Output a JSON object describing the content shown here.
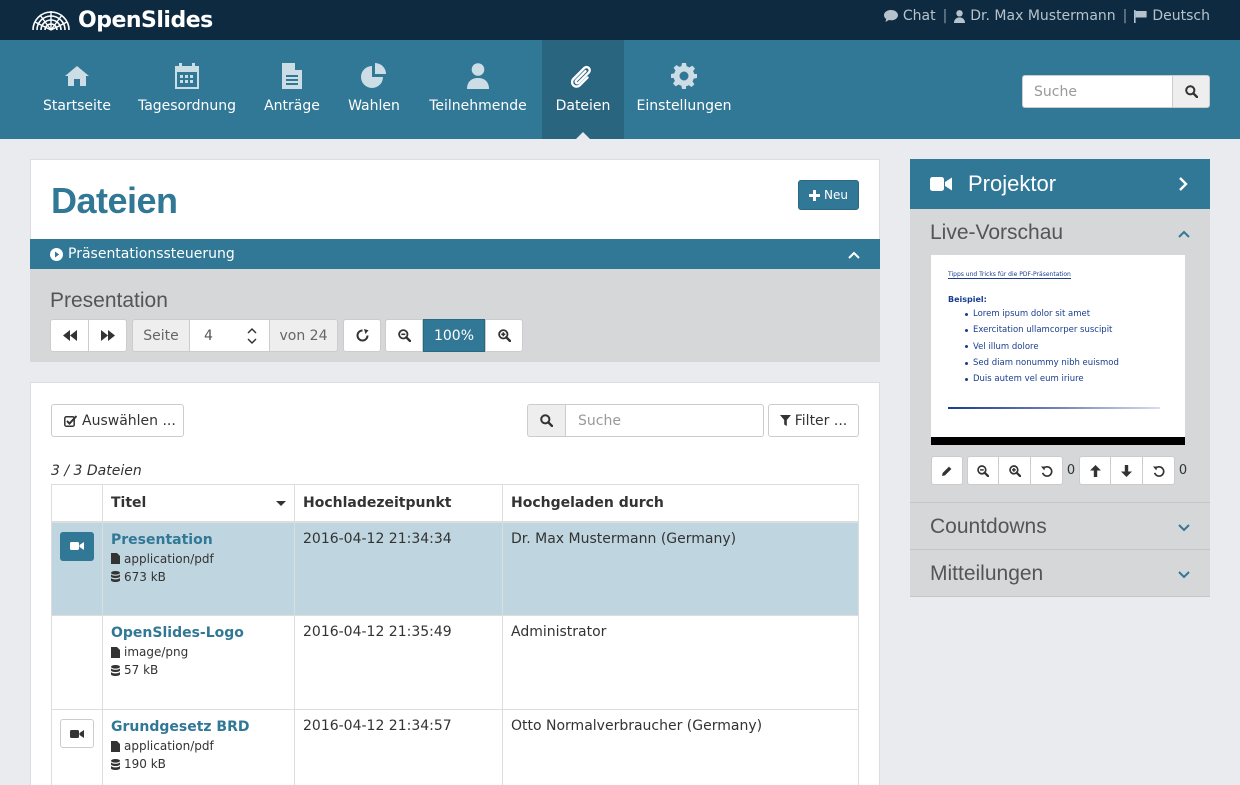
{
  "app": {
    "name": "OpenSlides"
  },
  "topbar": {
    "chat": "Chat",
    "user": "Dr. Max Mustermann",
    "language": "Deutsch"
  },
  "nav": {
    "items": [
      {
        "label": "Startseite",
        "icon": "home-icon"
      },
      {
        "label": "Tagesordnung",
        "icon": "calendar-icon"
      },
      {
        "label": "Anträge",
        "icon": "file-text-icon"
      },
      {
        "label": "Wahlen",
        "icon": "pie-chart-icon"
      },
      {
        "label": "Teilnehmende",
        "icon": "user-icon"
      },
      {
        "label": "Dateien",
        "icon": "paperclip-icon",
        "active": true
      },
      {
        "label": "Einstellungen",
        "icon": "gear-icon"
      }
    ],
    "search_placeholder": "Suche"
  },
  "page": {
    "title": "Dateien",
    "new_button": "Neu"
  },
  "presentation_control": {
    "header": "Präsentationssteuerung",
    "file_name": "Presentation",
    "page_label": "Seite",
    "page_value": "4",
    "total_label": "von 24",
    "zoom": "100%"
  },
  "files": {
    "select_button": "Auswählen ...",
    "search_placeholder": "Suche",
    "filter_button": "Filter ...",
    "count_text": "3 / 3 Dateien",
    "columns": [
      "Titel",
      "Hochladezeitpunkt",
      "Hochgeladen durch"
    ],
    "rows": [
      {
        "title": "Presentation",
        "type": "application/pdf",
        "size": "673 kB",
        "uploaded": "2016-04-12 21:34:34",
        "by": "Dr. Max Mustermann (Germany)",
        "projectable": true,
        "projected": true
      },
      {
        "title": "OpenSlides-Logo",
        "type": "image/png",
        "size": "57 kB",
        "uploaded": "2016-04-12 21:35:49",
        "by": "Administrator",
        "projectable": false,
        "projected": false
      },
      {
        "title": "Grundgesetz BRD",
        "type": "application/pdf",
        "size": "190 kB",
        "uploaded": "2016-04-12 21:34:57",
        "by": "Otto Normalverbraucher (Germany)",
        "projectable": true,
        "projected": false
      }
    ]
  },
  "projector": {
    "title": "Projektor",
    "live_preview": "Live-Vorschau",
    "slide": {
      "title": "Tipps und Tricks für die PDF-Präsentation",
      "subtitle": "Beispiel:",
      "bullets": [
        "Lorem ipsum dolor sit amet",
        "Exercitation ullamcorper suscipit",
        "Vel illum dolore",
        "Sed diam nonummy nibh euismod",
        "Duis autem vel eum iriure"
      ]
    },
    "rotate_count": "0",
    "scroll_count": "0",
    "countdowns": "Countdowns",
    "messages": "Mitteilungen"
  },
  "colors": {
    "primary": "#317796",
    "header_dark": "#0d2a40",
    "active_row": "#bfd6e0"
  }
}
